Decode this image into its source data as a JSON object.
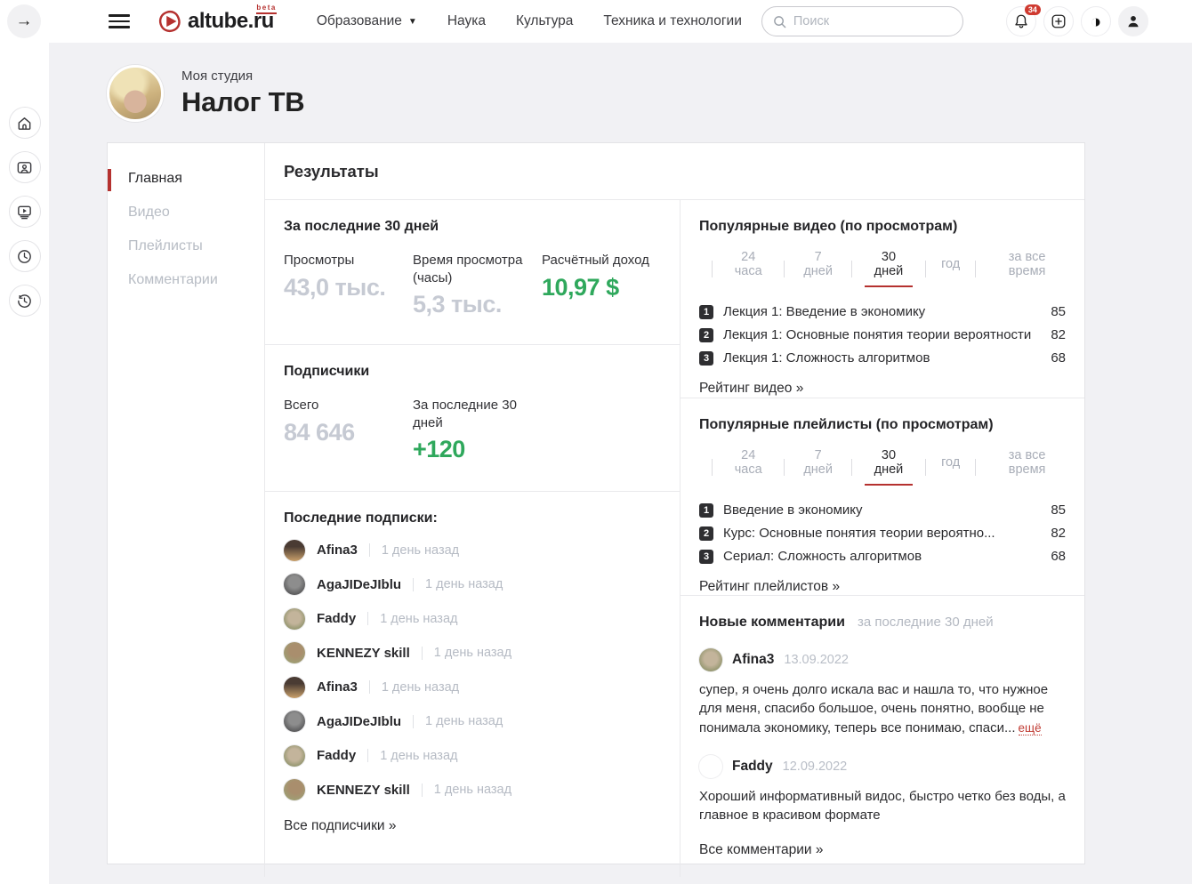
{
  "colors": {
    "accent_red": "#b5312f",
    "badge_red": "#cf3a30",
    "positive_green": "#2fa85c",
    "muted_number": "#c6cad3",
    "page_bg": "#f1f1f4"
  },
  "header": {
    "logo_text": "altube.ru",
    "logo_beta": "beta",
    "nav_items": [
      "Образование",
      "Наука",
      "Культура",
      "Техника и технологии"
    ],
    "search_placeholder": "Поиск",
    "notifications_count": "34"
  },
  "studio": {
    "label": "Моя студия",
    "title": "Налог ТВ"
  },
  "studio_nav": {
    "items": [
      {
        "label": "Главная",
        "active": true
      },
      {
        "label": "Видео"
      },
      {
        "label": "Плейлисты"
      },
      {
        "label": "Комментарии"
      }
    ]
  },
  "results": {
    "title": "Результаты",
    "period": {
      "title": "За последние 30 дней",
      "stats": [
        {
          "label": "Просмотры",
          "value": "43,0 тыс."
        },
        {
          "label": "Время просмотра (часы)",
          "value": "5,3 тыс."
        },
        {
          "label": "Расчётный доход",
          "value": "10,97 $"
        }
      ]
    },
    "subscribers": {
      "title": "Подписчики",
      "stats": [
        {
          "label": "Всего",
          "value": "84 646"
        },
        {
          "label": "За последние 30 дней",
          "value": "+120"
        }
      ]
    },
    "recent_subs": {
      "title": "Последние подписки:",
      "items": [
        {
          "name": "Afina3",
          "time": "1 день назад"
        },
        {
          "name": "AgaJIDeJIblu",
          "time": "1 день назад"
        },
        {
          "name": "Faddy",
          "time": "1 день назад"
        },
        {
          "name": "KENNEZY skill",
          "time": "1 день назад"
        },
        {
          "name": "Afina3",
          "time": "1 день назад"
        },
        {
          "name": "AgaJIDeJIblu",
          "time": "1 день назад"
        },
        {
          "name": "Faddy",
          "time": "1 день назад"
        },
        {
          "name": "KENNEZY skill",
          "time": "1 день назад"
        }
      ],
      "all_link": "Все подписчики »"
    }
  },
  "popular_videos": {
    "title": "Популярные видео (по просмотрам)",
    "tabs": [
      "24 часа",
      "7 дней",
      "30 дней",
      "год",
      "за все время"
    ],
    "active_tab": "30 дней",
    "items": [
      {
        "rank": "1",
        "title": "Лекция 1: Введение в экономику",
        "value": "85"
      },
      {
        "rank": "2",
        "title": "Лекция 1: Основные понятия теории вероятности",
        "value": "82"
      },
      {
        "rank": "3",
        "title": "Лекция 1: Сложность алгоритмов",
        "value": "68"
      }
    ],
    "link": "Рейтинг видео »"
  },
  "popular_playlists": {
    "title": "Популярные плейлисты (по просмотрам)",
    "tabs": [
      "24 часа",
      "7 дней",
      "30 дней",
      "год",
      "за все время"
    ],
    "active_tab": "30 дней",
    "items": [
      {
        "rank": "1",
        "title": "Введение в экономику",
        "value": "85"
      },
      {
        "rank": "2",
        "title": "Курс: Основные понятия теории вероятно...",
        "value": "82"
      },
      {
        "rank": "3",
        "title": "Сериал: Сложность алгоритмов",
        "value": "68"
      }
    ],
    "link": "Рейтинг плейлистов »"
  },
  "comments": {
    "title": "Новые комментарии",
    "subtitle": "за последние 30 дней",
    "items": [
      {
        "author": "Afina3",
        "date": "13.09.2022",
        "text": "супер, я очень долго искала вас и нашла то, что нужное для меня, спасибо большое, очень понятно, вообще не понимала экономику, теперь все понимаю, спаси...",
        "more_label": "ещё"
      },
      {
        "author": "Faddy",
        "date": "12.09.2022",
        "text": "Хороший информативный видос, быстро четко без воды, а главное в красивом формате"
      }
    ],
    "link": "Все комментарии »"
  }
}
